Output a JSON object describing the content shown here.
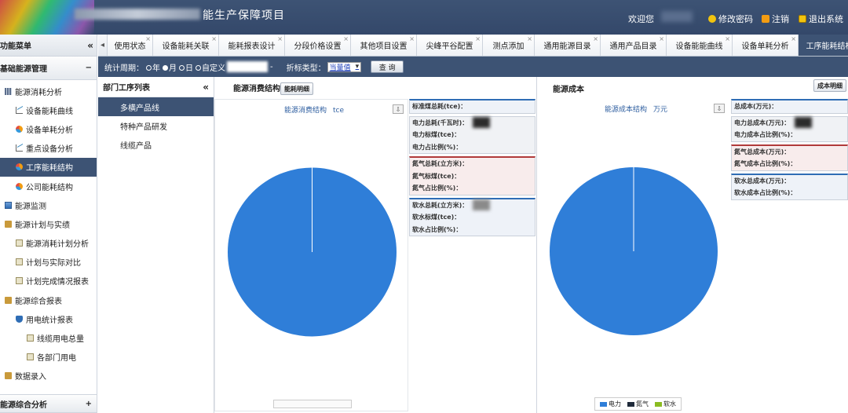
{
  "header": {
    "title": "能生产保障项目",
    "welcome": "欢迎您",
    "links": [
      {
        "label": "修改密码",
        "icon": "key-icon"
      },
      {
        "label": "注销",
        "icon": "logout-icon"
      },
      {
        "label": "退出系统",
        "icon": "exit-icon"
      }
    ]
  },
  "sidebar": {
    "title": "功能菜单",
    "collapse": "«",
    "section": "基础能源管理",
    "section_toggle": "−",
    "items": [
      {
        "label": "能源消耗分析",
        "level": 1,
        "icon": "grid-icon"
      },
      {
        "label": "设备能耗曲线",
        "level": 2,
        "icon": "line-chart-icon"
      },
      {
        "label": "设备单耗分析",
        "level": 2,
        "icon": "pie-chart-icon"
      },
      {
        "label": "重点设备分析",
        "level": 2,
        "icon": "line-chart-icon"
      },
      {
        "label": "工序能耗结构",
        "level": 2,
        "icon": "pie-chart-icon",
        "active": true
      },
      {
        "label": "公司能耗结构",
        "level": 2,
        "icon": "pie-chart-icon"
      },
      {
        "label": "能源监测",
        "level": 1,
        "icon": "monitor-icon"
      },
      {
        "label": "能源计划与实绩",
        "level": 1,
        "icon": "folder-icon"
      },
      {
        "label": "能源消耗计划分析",
        "level": 2,
        "icon": "doc-icon"
      },
      {
        "label": "计划与实际对比",
        "level": 2,
        "icon": "doc-icon"
      },
      {
        "label": "计划完成情况报表",
        "level": 2,
        "icon": "doc-icon"
      },
      {
        "label": "能源综合报表",
        "level": 1,
        "icon": "folder-icon"
      },
      {
        "label": "用电统计报表",
        "level": 2,
        "icon": "shield-icon"
      },
      {
        "label": "线缆用电总量",
        "level": 3,
        "icon": "doc-icon"
      },
      {
        "label": "各部门用电",
        "level": 3,
        "icon": "doc-icon"
      },
      {
        "label": "数据录入",
        "level": 1,
        "icon": "folder-icon"
      }
    ],
    "footer_section": "能源综合分析",
    "footer_toggle": "+"
  },
  "tabs": {
    "left_arrow": "◂",
    "items": [
      {
        "label": "使用状态",
        "active": false
      },
      {
        "label": "设备能耗关联",
        "active": false
      },
      {
        "label": "能耗报表设计",
        "active": false
      },
      {
        "label": "分段价格设置",
        "active": false
      },
      {
        "label": "其他项目设置",
        "active": false
      },
      {
        "label": "尖峰平谷配置",
        "active": false
      },
      {
        "label": "测点添加",
        "active": false
      },
      {
        "label": "通用能源目录",
        "active": false
      },
      {
        "label": "通用产品目录",
        "active": false
      },
      {
        "label": "设备能能曲线",
        "active": false
      },
      {
        "label": "设备单耗分析",
        "active": false
      },
      {
        "label": "工序能耗结构",
        "active": true
      }
    ],
    "close": "×"
  },
  "filter": {
    "period_label": "统计周期：",
    "options": [
      {
        "label": "年",
        "checked": false
      },
      {
        "label": "月",
        "checked": true
      },
      {
        "label": "日",
        "checked": false
      },
      {
        "label": "自定义",
        "checked": false
      }
    ],
    "range_sep": "-",
    "type_label": "折标类型：",
    "type_value": "当量值",
    "query": "查 询"
  },
  "dept": {
    "title": "部门工序列表",
    "collapse": "«",
    "items": [
      {
        "label": "多横产品线",
        "active": true
      },
      {
        "label": "特种产品研发",
        "active": false
      },
      {
        "label": "线缆产品",
        "active": false
      }
    ]
  },
  "energy_panel": {
    "title": "能源消费结构",
    "detail_btn": "能耗明细",
    "chart_title": "能源消费结构",
    "chart_unit": "tce",
    "download": "⇩",
    "total": "标准煤总耗(tce)：",
    "groups": [
      {
        "rows": [
          "电力总耗(千瓦时)：",
          "电力标煤(tce)：",
          "电力占比例(%)："
        ],
        "style": "plain"
      },
      {
        "rows": [
          "氮气总耗(立方米)：",
          "氮气标煤(tce)：",
          "氮气占比例(%)："
        ],
        "style": "red"
      },
      {
        "rows": [
          "软水总耗(立方米)：",
          "软水标煤(tce)：",
          "软水占比例(%)："
        ],
        "style": "blue"
      }
    ]
  },
  "cost_panel": {
    "title": "能源成本",
    "detail_btn": "成本明细",
    "chart_title": "能源成本结构",
    "chart_unit": "万元",
    "download": "⇩",
    "total": "总成本(万元)：",
    "groups": [
      {
        "rows": [
          "电力总成本(万元)：",
          "电力成本占比例(%)："
        ],
        "style": "plain"
      },
      {
        "rows": [
          "氮气总成本(万元)：",
          "氮气成本占比例(%)："
        ],
        "style": "red"
      },
      {
        "rows": [
          "软水总成本(万元)：",
          "软水成本占比例(%)："
        ],
        "style": "blue"
      }
    ],
    "legend": [
      {
        "label": "电力",
        "color": "#2f7ed8"
      },
      {
        "label": "氮气",
        "color": "#1f2a3a"
      },
      {
        "label": "软水",
        "color": "#8bbc21"
      }
    ]
  },
  "chart_data": [
    {
      "type": "pie",
      "categories": [
        "电力",
        "氮气",
        "软水"
      ],
      "values": [
        100,
        0,
        0
      ],
      "colors": [
        "#2f7ed8",
        "#1f2a3a",
        "#8bbc21"
      ],
      "title": "能源消费结构",
      "unit": "tce"
    },
    {
      "type": "pie",
      "categories": [
        "电力",
        "氮气",
        "软水"
      ],
      "values": [
        100,
        0,
        0
      ],
      "colors": [
        "#2f7ed8",
        "#1f2a3a",
        "#8bbc21"
      ],
      "title": "能源成本结构",
      "unit": "万元"
    }
  ]
}
